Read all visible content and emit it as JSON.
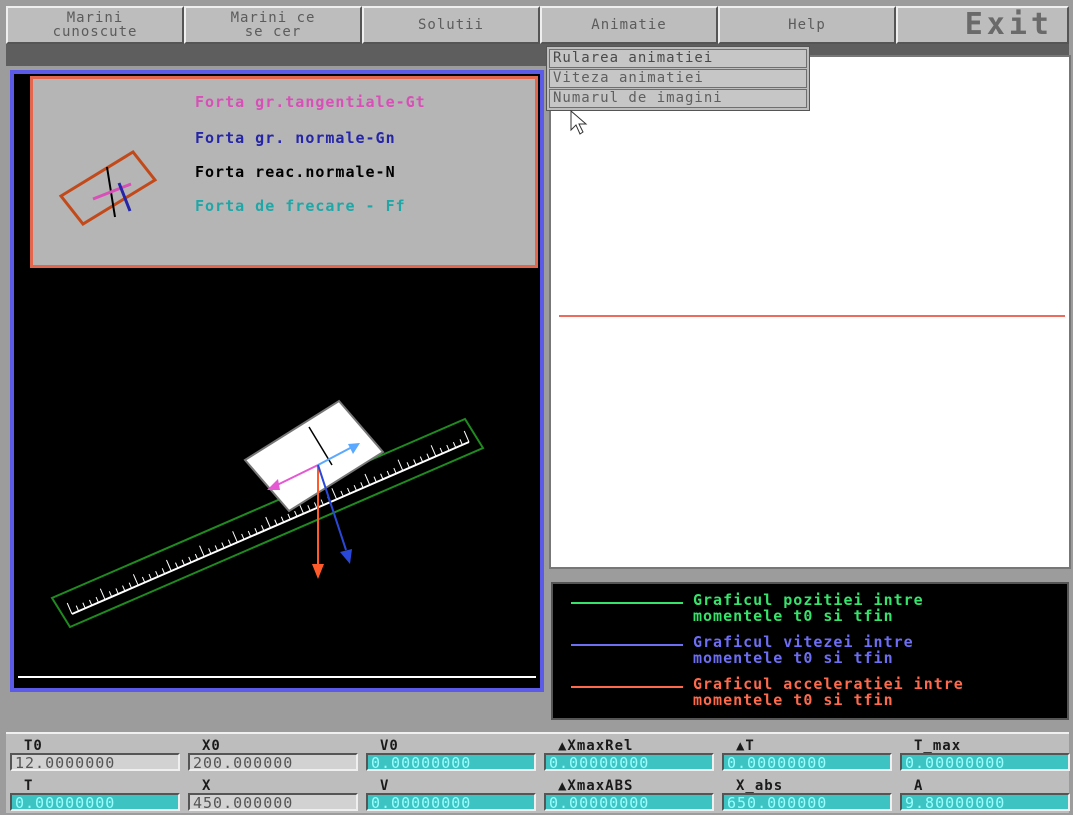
{
  "menu": {
    "items": [
      {
        "label": "Marini\ncunoscute"
      },
      {
        "label": "Marini ce\nse cer"
      },
      {
        "label": "Solutii"
      },
      {
        "label": "Animatie"
      },
      {
        "label": "Help"
      },
      {
        "label": "Exit"
      }
    ]
  },
  "dropdown": {
    "items": [
      "Rularea animatiei",
      "Viteza animatiei",
      "Numarul de imagini"
    ]
  },
  "force_legend": {
    "items": [
      {
        "label": "Forta gr.tangentiale-Gt",
        "color": "#d74fb7"
      },
      {
        "label": "Forta gr. normale-Gn",
        "color": "#2525a8"
      },
      {
        "label": "Forta reac.normale-N",
        "color": "#000000"
      },
      {
        "label": "Forta de frecare - Ff",
        "color": "#1fa7a7"
      }
    ]
  },
  "graph_legend": {
    "items": [
      {
        "label": "Graficul pozitiei intre\nmomentele t0 si tfin",
        "color": "#36e36b"
      },
      {
        "label": "Graficul vitezei intre\nmomentele t0 si tfin",
        "color": "#6e6ef5"
      },
      {
        "label": "Graficul acceleratiei intre\nmomentele t0 si tfin",
        "color": "#ff6a4d"
      }
    ]
  },
  "params": {
    "row1": [
      {
        "label": "T0",
        "value": "12.0000000",
        "style": "light"
      },
      {
        "label": "X0",
        "value": "200.000000",
        "style": "light"
      },
      {
        "label": "V0",
        "value": "0.00000000",
        "style": "cyan"
      },
      {
        "label": "▲XmaxRel",
        "value": "0.00000000",
        "style": "cyan"
      },
      {
        "label": "▲T",
        "value": "0.00000000",
        "style": "cyan"
      },
      {
        "label": "T_max",
        "value": "0.00000000",
        "style": "cyan"
      }
    ],
    "row2": [
      {
        "label": "T",
        "value": "0.00000000",
        "style": "cyan"
      },
      {
        "label": "X",
        "value": "450.000000",
        "style": "light"
      },
      {
        "label": "V",
        "value": "0.00000000",
        "style": "cyan"
      },
      {
        "label": "▲XmaxABS",
        "value": "0.00000000",
        "style": "cyan"
      },
      {
        "label": "X_abs",
        "value": "650.000000",
        "style": "cyan"
      },
      {
        "label": "A",
        "value": "9.80000000",
        "style": "cyan"
      }
    ]
  },
  "colors": {
    "panel_border": "#5b5be8",
    "incline": "#1f8a1f",
    "scale_ticks": "#ffffff",
    "arrow_gt": "#e557d3",
    "arrow_gn": "#2a48d8",
    "arrow_n": "#5aa8ff",
    "arrow_g": "#ff5a2a",
    "accel_line": "#ee6a5a"
  }
}
